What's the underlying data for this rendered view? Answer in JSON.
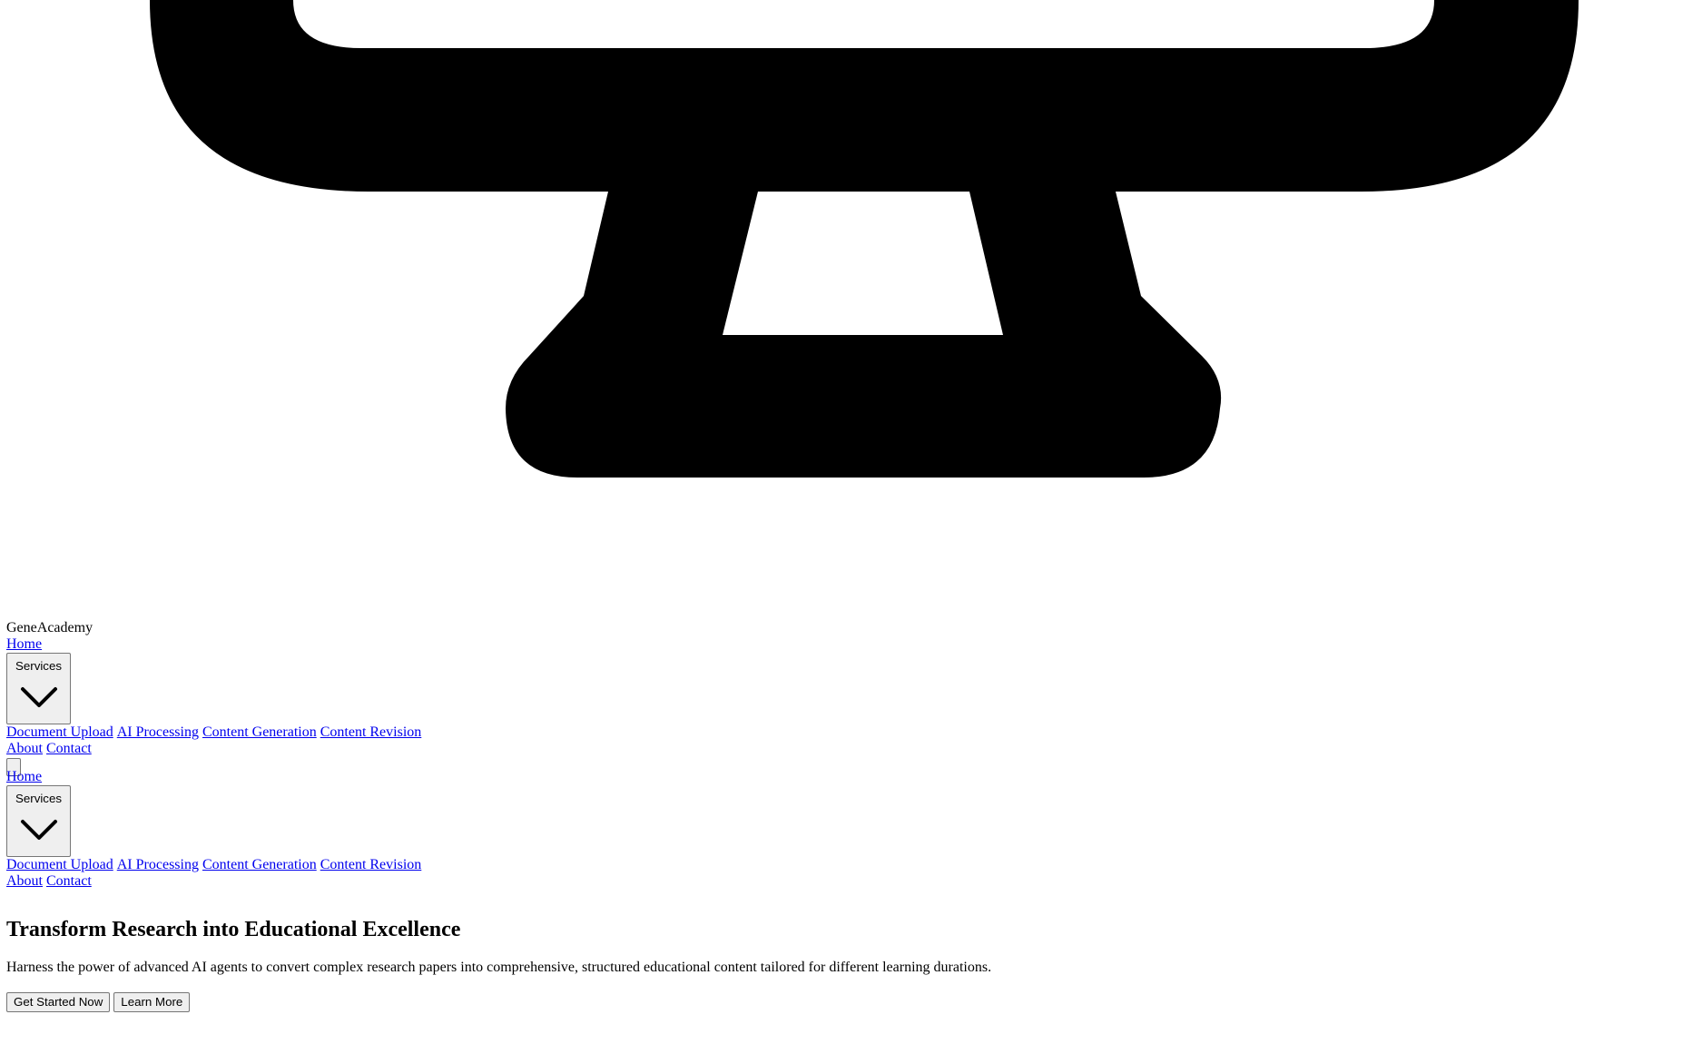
{
  "brand": {
    "name": "GeneAcademy",
    "icon": "monitor-icon"
  },
  "desktop_nav": {
    "home": "Home",
    "services": "Services",
    "services_items": [
      "Document Upload",
      "AI Processing",
      "Content Generation",
      "Content Revision"
    ],
    "about": "About",
    "contact": "Contact"
  },
  "mobile_menu_button": {
    "label": ""
  },
  "mobile_nav": {
    "home": "Home",
    "services": "Services",
    "services_items": [
      "Document Upload",
      "AI Processing",
      "Content Generation",
      "Content Revision"
    ],
    "about": "About",
    "contact": "Contact"
  },
  "hero": {
    "title": "Transform Research into Educational Excellence",
    "description": "Harness the power of advanced AI agents to convert complex research papers into comprehensive, structured educational content tailored for different learning durations.",
    "primary_button": "Get Started Now",
    "secondary_button": "Learn More"
  }
}
